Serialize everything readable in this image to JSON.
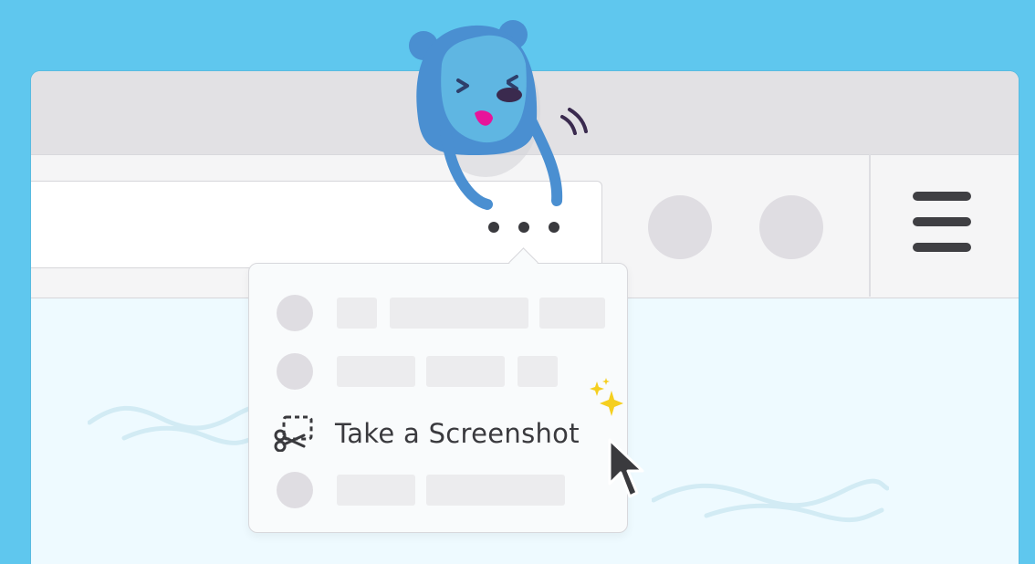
{
  "menu": {
    "take_screenshot_label": "Take a Screenshot"
  },
  "icons": {
    "menu": "three-dots-icon",
    "screenshot": "scissors-screenshot-icon",
    "hamburger": "hamburger-menu-icon",
    "cursor": "mouse-pointer-icon",
    "sparkle": "sparkle-icon",
    "mascot": "bear-mascot-illustration"
  },
  "colors": {
    "background": "#5fc7ee",
    "mascot": "#4a8fd1",
    "tongue": "#e8149a",
    "sparkle": "#f5cf1f"
  }
}
